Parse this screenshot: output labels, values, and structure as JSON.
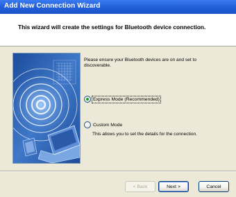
{
  "window": {
    "title": "Add New Connection Wizard"
  },
  "header": {
    "text": "This wizard will create the settings for Bluetooth device connection."
  },
  "main": {
    "instruction": "Please ensure your Bluetooth devices are on and set to discoverable.",
    "options": [
      {
        "label": "Express Mode (Recommended)",
        "checked": true
      },
      {
        "label": "Custom Mode",
        "checked": false,
        "description": "This allows you to set the details for the connection."
      }
    ]
  },
  "buttons": {
    "back": "< Back",
    "next": "Next >",
    "cancel": "Cancel"
  },
  "colors": {
    "titlebar": "#2462dc",
    "dialog_bg": "#ece9d8",
    "header_bg": "#ffffff",
    "image_bg": "#2c5fae"
  },
  "icons": [
    "bluetooth-wizard-illustration"
  ]
}
